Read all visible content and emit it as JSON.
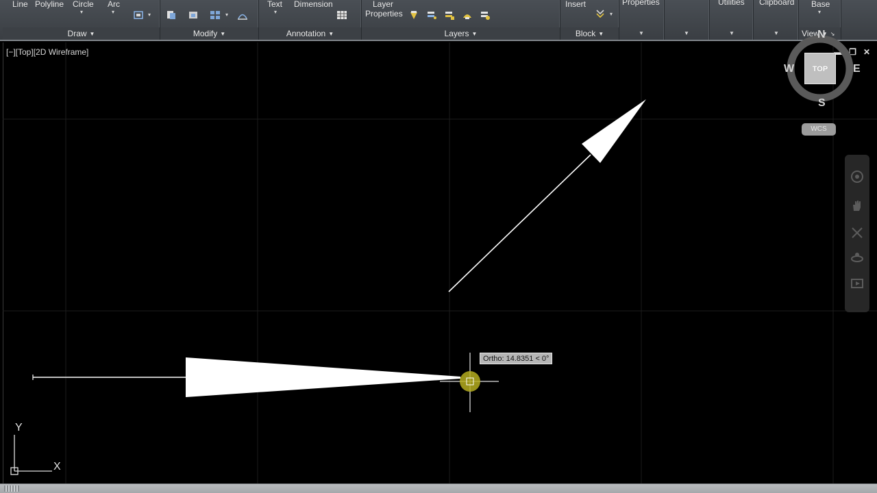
{
  "ribbon": {
    "draw": {
      "title": "Draw",
      "line_label": "Line",
      "polyline_label": "Polyline",
      "circle_label": "Circle",
      "arc_label": "Arc"
    },
    "modify": {
      "title": "Modify"
    },
    "annotation": {
      "title": "Annotation",
      "text_label": "Text",
      "dimension_label": "Dimension"
    },
    "layers": {
      "title": "Layers",
      "layer_properties_line1": "Layer",
      "layer_properties_line2": "Properties"
    },
    "block": {
      "title": "Block",
      "insert_label": "Insert"
    },
    "properties": {
      "label": "Properties"
    },
    "utilities": {
      "label": "Utilities"
    },
    "clipboard": {
      "label": "Clipboard"
    },
    "view": {
      "title": "View",
      "base_label": "Base"
    }
  },
  "viewport": {
    "label": "[−][Top][2D Wireframe]",
    "ortho_tooltip": "Ortho: 14.8351 < 0°",
    "ucs_x_label": "X",
    "ucs_y_label": "Y"
  },
  "viewcube": {
    "north": "N",
    "south": "S",
    "east": "E",
    "west": "W",
    "top_face": "TOP",
    "wcs_label": "WCS"
  },
  "colors": {
    "background": "#000000",
    "ribbon": "#43484d",
    "cursor_marker": "#b5ad1f",
    "geometry": "#ffffff"
  }
}
